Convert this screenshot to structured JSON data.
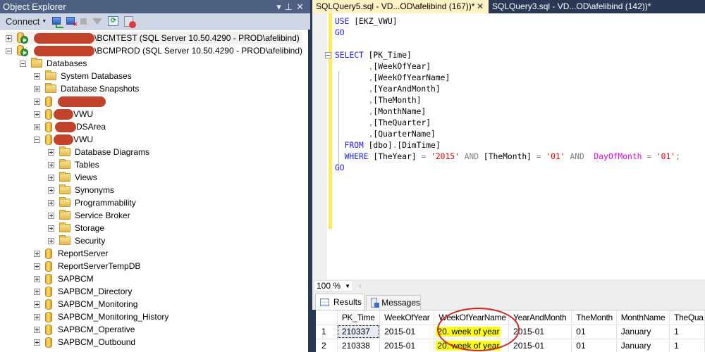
{
  "object_explorer": {
    "title": "Object Explorer",
    "title_controls": "▾ ⊥ ✕",
    "toolbar": {
      "connect_label": "Connect",
      "icons": [
        "connect-icon",
        "disconnect-icon",
        "stop-icon",
        "filter-icon",
        "refresh-icon",
        "stop-report-icon"
      ]
    },
    "servers": [
      {
        "name_suffix": "\\BCMTEST (SQL Server 10.50.4290 - PROD\\afelibind)",
        "expanded": false,
        "name_redacted": true
      },
      {
        "name_suffix": "\\BCMPROD (SQL Server 10.50.4290 - PROD\\afelibind)",
        "expanded": true,
        "name_redacted": true
      }
    ],
    "databases_label": "Databases",
    "database_folders": [
      "System Databases",
      "Database Snapshots"
    ],
    "databases": [
      {
        "name": "",
        "redacted": true
      },
      {
        "name": "VWU",
        "redacted": true
      },
      {
        "name": "DSArea",
        "redacted": true
      },
      {
        "name": "VWU",
        "redacted": true,
        "expanded": true
      }
    ],
    "db_children": [
      "Database Diagrams",
      "Tables",
      "Views",
      "Synonyms",
      "Programmability",
      "Service Broker",
      "Storage",
      "Security"
    ],
    "more_databases": [
      "ReportServer",
      "ReportServerTempDB",
      "SAPBCM",
      "SAPBCM_Directory",
      "SAPBCM_Monitoring",
      "SAPBCM_Monitoring_History",
      "SAPBCM_Operative",
      "SAPBCM_Outbound"
    ]
  },
  "tabs": [
    {
      "label": "SQLQuery5.sql - VD...OD\\afelibind (167))*",
      "active": true,
      "close": "✕"
    },
    {
      "label": "SQLQuery3.sql - VD...OD\\afelibind (142))*",
      "active": false
    }
  ],
  "editor": {
    "lines": {
      "l1a": "USE",
      "l1b": " [EKZ_VWU]",
      "l2": "GO",
      "l4a": "SELECT",
      "l4b": " [PK_Time]",
      "l5": "[WeekOfYear]",
      "l6": "[WeekOfYearName]",
      "l7": "[YearAndMonth]",
      "l8": "[TheMonth]",
      "l9": "[MonthName]",
      "l10": "[TheQuarter]",
      "l11": "[QuarterName]",
      "l12a": "FROM",
      "l12b": " [dbo]",
      "l12c": ".",
      "l12d": "[DimTime]",
      "l13a": "WHERE",
      "l13b": " [TheYear] ",
      "l13c": "=",
      "l13d": "'2015'",
      "l13e": "AND",
      "l13f": "[TheMonth] ",
      "l13g": "=",
      "l13h": "'01'",
      "l13i": "AND",
      "l13j": "DayOfMonth",
      "l13k": "=",
      "l13l": "'01'",
      "l13m": ";",
      "l14": "GO",
      "comma": ","
    },
    "zoom_level": "100 %"
  },
  "results": {
    "tabs": [
      "Results",
      "Messages"
    ],
    "columns": [
      "",
      "PK_Time",
      "WeekOfYear",
      "WeekOfYearName",
      "YearAndMonth",
      "TheMonth",
      "MonthName",
      "TheQua"
    ],
    "rows": [
      [
        "1",
        "210337",
        "2015-01",
        "20. week of year",
        "2015-01",
        "01",
        "January",
        "1"
      ],
      [
        "2",
        "210338",
        "2015-01",
        "20. week of year",
        "2015-01",
        "01",
        "January",
        "1"
      ]
    ],
    "annotation": {
      "highlight_color": "#ffff1a",
      "circle_color": "#d42424",
      "highlighted_column": "WeekOfYearName"
    }
  }
}
